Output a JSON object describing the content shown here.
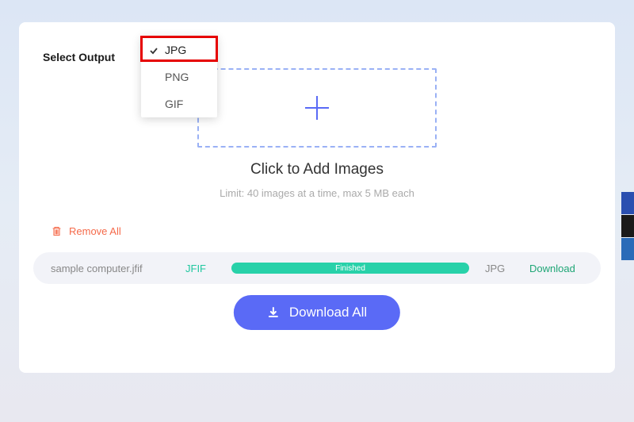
{
  "labels": {
    "select_output": "Select Output",
    "add_images": "Click to Add Images",
    "limit": "Limit: 40 images at a time, max 5 MB each",
    "remove_all": "Remove All",
    "download_all": "Download All"
  },
  "format_dropdown": {
    "options": [
      {
        "label": "JPG",
        "selected": true
      },
      {
        "label": "PNG",
        "selected": false
      },
      {
        "label": "GIF",
        "selected": false
      }
    ]
  },
  "file_row": {
    "name": "sample computer.jfif",
    "src_format": "JFIF",
    "status": "Finished",
    "dst_format": "JPG",
    "download_label": "Download"
  },
  "colors": {
    "accent": "#5a6af6",
    "success": "#28d1a9",
    "danger": "#f56a4a",
    "highlight_border": "#e60000"
  }
}
